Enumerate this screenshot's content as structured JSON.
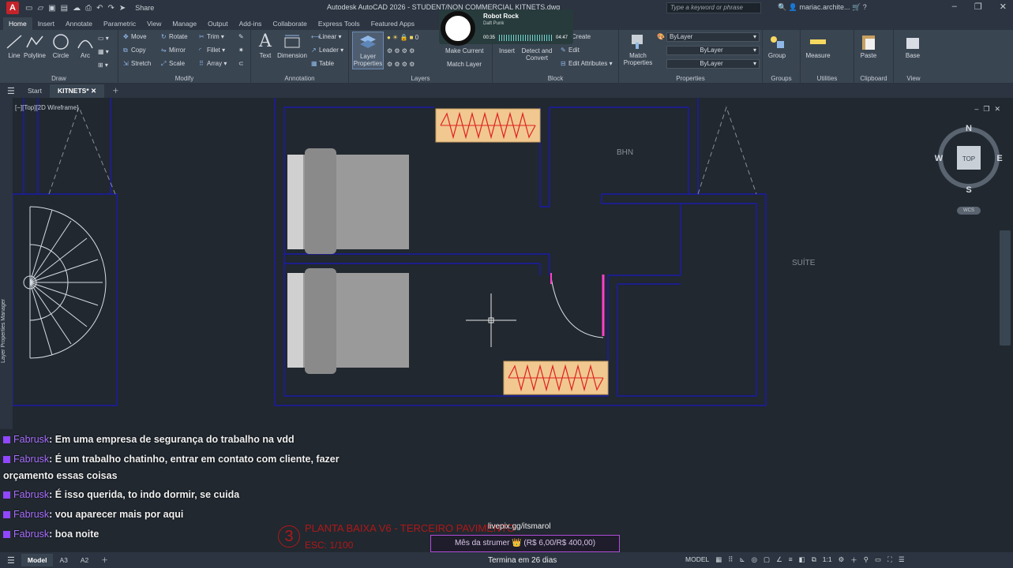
{
  "titlebar": {
    "logo": "A",
    "share": "Share",
    "title": "Autodesk AutoCAD 2026 - STUDENT/NON COMMERCIAL    KITNETS.dwg",
    "search_placeholder": "Type a keyword or phrase",
    "user": "mariac.archite..."
  },
  "ribbon_tabs": [
    "Home",
    "Insert",
    "Annotate",
    "Parametric",
    "View",
    "Manage",
    "Output",
    "Add-ins",
    "Collaborate",
    "Express Tools",
    "Featured Apps"
  ],
  "ribbon": {
    "draw": {
      "label": "Draw",
      "line": "Line",
      "polyline": "Polyline",
      "circle": "Circle",
      "arc": "Arc"
    },
    "modify": {
      "label": "Modify",
      "move": "Move",
      "rotate": "Rotate",
      "trim": "Trim",
      "copy": "Copy",
      "mirror": "Mirror",
      "fillet": "Fillet",
      "stretch": "Stretch",
      "scale": "Scale",
      "array": "Array"
    },
    "annotation": {
      "label": "Annotation",
      "text": "Text",
      "dimension": "Dimension",
      "linear": "Linear",
      "leader": "Leader",
      "table": "Table"
    },
    "layers": {
      "label": "Layers",
      "layer_properties_1": "Layer",
      "layer_properties_2": "Properties",
      "current_layer": "0",
      "make_current": "Make Current",
      "match_layer": "Match Layer"
    },
    "block": {
      "label": "Block",
      "insert": "Insert",
      "detect_1": "Detect and",
      "detect_2": "Convert",
      "create": "Create",
      "edit": "Edit",
      "edit_attributes": "Edit Attributes"
    },
    "properties": {
      "label": "Properties",
      "match_1": "Match",
      "match_2": "Properties",
      "color": "ByLayer",
      "linetype": "ByLayer",
      "lineweight": "ByLayer"
    },
    "groups": {
      "label": "Groups",
      "group": "Group"
    },
    "utilities": {
      "label": "Utilities",
      "measure": "Measure"
    },
    "clipboard": {
      "label": "Clipboard",
      "paste": "Paste"
    },
    "view": {
      "label": "View",
      "base": "Base"
    }
  },
  "music": {
    "title": "Robot Rock",
    "artist": "Daft Punk",
    "elapsed": "00:35",
    "total": "04:47"
  },
  "file_tabs": {
    "start": "Start",
    "active": "KITNETS*"
  },
  "viewport": {
    "label": "[−][Top][2D Wireframe]",
    "viewcube": {
      "n": "N",
      "s": "S",
      "e": "E",
      "w": "W",
      "top": "TOP",
      "wcs": "WCS"
    },
    "side_panel": "Layer Properties Manager",
    "room_bhn": "BHN",
    "room_suite": "SUÍTE"
  },
  "chat": [
    {
      "user": "Fabrusk",
      "message": ": Em uma empresa de segurança do trabalho na vdd"
    },
    {
      "user": "Fabrusk",
      "message": ": É um trabalho chatinho, entrar em contato com cliente, fazer"
    },
    {
      "user": "",
      "message": "orçamento essas coisas"
    },
    {
      "user": "Fabrusk",
      "message": ": É isso querida, to indo dormir, se cuida"
    },
    {
      "user": "Fabrusk",
      "message": ": vou aparecer mais por aqui"
    },
    {
      "user": "Fabrusk",
      "message": ": boa noite"
    }
  ],
  "plan": {
    "number": "3",
    "title": "PLANTA BAIXA V6 - TERCEIRO PAVIMENTO",
    "scale": "ESC: 1/100"
  },
  "donation": {
    "link": "livepix.gg/itsmarol",
    "bar": "Mês da strumer 👑 (R$ 6,00/R$ 400,00)",
    "ends": "Termina em 26 dias"
  },
  "status": {
    "tabs": [
      "Model",
      "A3",
      "A2"
    ],
    "mode": "MODEL",
    "scale": "1:1"
  },
  "colors": {
    "wall": "#1a1aa8",
    "bed_body": "#9a9a9a",
    "radiator_fill": "#f0c890",
    "radiator_zigzag": "#e02020",
    "door": "#ff40c8",
    "chat_user": "#a970ff"
  }
}
